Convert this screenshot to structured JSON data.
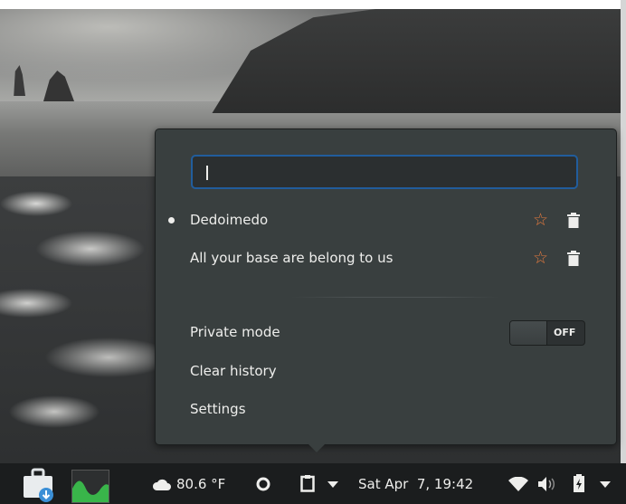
{
  "clipboard_popover": {
    "search": {
      "value": "",
      "placeholder": ""
    },
    "entries": [
      {
        "label": "Dedoimedo",
        "active": true,
        "star_icon": "star-outline-icon",
        "delete_icon": "trash-icon"
      },
      {
        "label": "All your base are belong to us",
        "active": false,
        "star_icon": "star-outline-icon",
        "delete_icon": "trash-icon"
      }
    ],
    "private_mode": {
      "label": "Private mode",
      "state": "OFF"
    },
    "clear_history_label": "Clear history",
    "settings_label": "Settings"
  },
  "panel": {
    "weather": {
      "icon": "weather-cloud-icon",
      "temperature": "80.6 °F"
    },
    "clipboard_icon": "clipboard-icon",
    "clock": "Sat Apr  7, 19:42",
    "status_icons": [
      "wifi-icon",
      "volume-icon",
      "battery-icon",
      "chevron-down-icon"
    ]
  },
  "colors": {
    "popover_bg": "#393f3f",
    "accent_border": "#215d9c",
    "star": "#e47a3f",
    "panel_bg": "#1b1d1e",
    "text": "#eeeeec"
  }
}
